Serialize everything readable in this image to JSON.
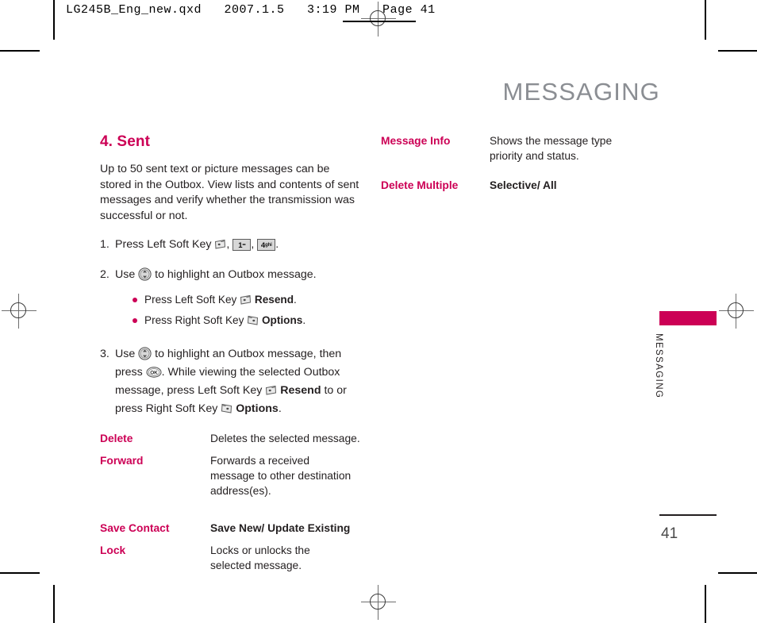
{
  "print_header": {
    "text": "LG245B_Eng_new.qxd   2007.1.5   3:19 PM   Page 41"
  },
  "page_title": "MESSAGING",
  "colors": {
    "accent": "#cc0055",
    "title_gray": "#8b8e93",
    "body": "#231f20"
  },
  "left_column": {
    "section_heading": "4. Sent",
    "intro": "Up to 50 sent text or picture messages can be stored in the Outbox. View lists and contents of sent messages and verify whether the transmission was successful or not.",
    "steps": [
      {
        "number": "1.",
        "before": "Press Left Soft Key",
        "icons": [
          "soft-key-left-icon",
          "key-1-icon",
          "key-4-ghi-icon"
        ],
        "key1_label": "1",
        "key1_sub": "••",
        "key4_label": "4",
        "key4_sub": "ghi",
        "after": "."
      },
      {
        "number": "2.",
        "before": "Use",
        "icons": [
          "nav-updown-icon"
        ],
        "after": "to highlight an Outbox message."
      },
      {
        "number": "3.",
        "part1": "Use",
        "part2": "to highlight an Outbox message, then press",
        "part3": ". While viewing the selected Outbox message, press Left Soft Key",
        "part4": "Resend",
        "part5": "to or press Right Soft Key",
        "part6": "Options",
        "part7": "."
      }
    ],
    "bullets": [
      {
        "text_before": "Press Left Soft Key",
        "icon": "soft-key-left-icon",
        "bold_label": "Resend",
        "text_after": "."
      },
      {
        "text_before": "Press Right Soft Key",
        "icon": "soft-key-right-icon",
        "bold_label": "Options",
        "text_after": "."
      }
    ],
    "definitions": [
      {
        "term": "Delete",
        "desc": "Deletes the selected message.",
        "bold": false
      },
      {
        "term": "Forward",
        "desc": "Forwards a received message to other destination address(es).",
        "bold": false
      },
      {
        "term": "Save Contact",
        "desc": "Save New/ Update Existing",
        "bold": true
      },
      {
        "term": "Lock",
        "desc": "Locks or unlocks the selected message.",
        "bold": false
      }
    ]
  },
  "right_column": {
    "definitions": [
      {
        "term": "Message Info",
        "desc": "Shows the message type priority and status.",
        "bold": false
      },
      {
        "term": "Delete Multiple",
        "desc": "Selective/ All",
        "bold": true
      }
    ]
  },
  "side_tab": {
    "label": "MESSAGING"
  },
  "page_number": "41"
}
